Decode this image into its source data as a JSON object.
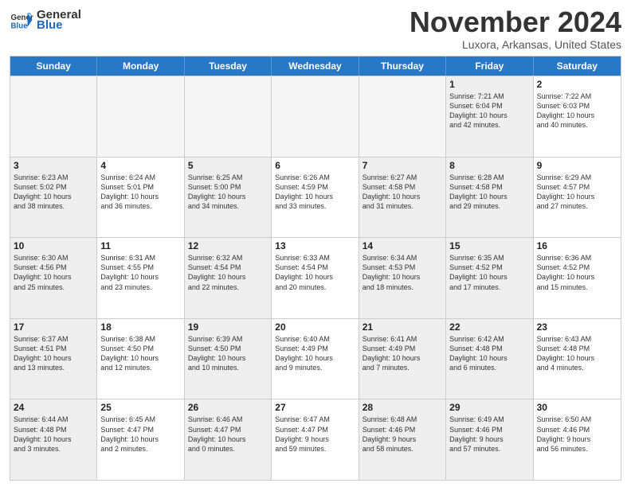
{
  "header": {
    "logo_general": "General",
    "logo_blue": "Blue",
    "month_title": "November 2024",
    "location": "Luxora, Arkansas, United States"
  },
  "weekdays": [
    "Sunday",
    "Monday",
    "Tuesday",
    "Wednesday",
    "Thursday",
    "Friday",
    "Saturday"
  ],
  "rows": [
    [
      {
        "day": "",
        "empty": true
      },
      {
        "day": "",
        "empty": true
      },
      {
        "day": "",
        "empty": true
      },
      {
        "day": "",
        "empty": true
      },
      {
        "day": "",
        "empty": true
      },
      {
        "day": "1",
        "info": "Sunrise: 7:21 AM\nSunset: 6:04 PM\nDaylight: 10 hours\nand 42 minutes.",
        "shaded": true
      },
      {
        "day": "2",
        "info": "Sunrise: 7:22 AM\nSunset: 6:03 PM\nDaylight: 10 hours\nand 40 minutes."
      }
    ],
    [
      {
        "day": "3",
        "info": "Sunrise: 6:23 AM\nSunset: 5:02 PM\nDaylight: 10 hours\nand 38 minutes.",
        "shaded": true
      },
      {
        "day": "4",
        "info": "Sunrise: 6:24 AM\nSunset: 5:01 PM\nDaylight: 10 hours\nand 36 minutes."
      },
      {
        "day": "5",
        "info": "Sunrise: 6:25 AM\nSunset: 5:00 PM\nDaylight: 10 hours\nand 34 minutes.",
        "shaded": true
      },
      {
        "day": "6",
        "info": "Sunrise: 6:26 AM\nSunset: 4:59 PM\nDaylight: 10 hours\nand 33 minutes."
      },
      {
        "day": "7",
        "info": "Sunrise: 6:27 AM\nSunset: 4:58 PM\nDaylight: 10 hours\nand 31 minutes.",
        "shaded": true
      },
      {
        "day": "8",
        "info": "Sunrise: 6:28 AM\nSunset: 4:58 PM\nDaylight: 10 hours\nand 29 minutes.",
        "shaded": true
      },
      {
        "day": "9",
        "info": "Sunrise: 6:29 AM\nSunset: 4:57 PM\nDaylight: 10 hours\nand 27 minutes."
      }
    ],
    [
      {
        "day": "10",
        "info": "Sunrise: 6:30 AM\nSunset: 4:56 PM\nDaylight: 10 hours\nand 25 minutes.",
        "shaded": true
      },
      {
        "day": "11",
        "info": "Sunrise: 6:31 AM\nSunset: 4:55 PM\nDaylight: 10 hours\nand 23 minutes."
      },
      {
        "day": "12",
        "info": "Sunrise: 6:32 AM\nSunset: 4:54 PM\nDaylight: 10 hours\nand 22 minutes.",
        "shaded": true
      },
      {
        "day": "13",
        "info": "Sunrise: 6:33 AM\nSunset: 4:54 PM\nDaylight: 10 hours\nand 20 minutes."
      },
      {
        "day": "14",
        "info": "Sunrise: 6:34 AM\nSunset: 4:53 PM\nDaylight: 10 hours\nand 18 minutes.",
        "shaded": true
      },
      {
        "day": "15",
        "info": "Sunrise: 6:35 AM\nSunset: 4:52 PM\nDaylight: 10 hours\nand 17 minutes.",
        "shaded": true
      },
      {
        "day": "16",
        "info": "Sunrise: 6:36 AM\nSunset: 4:52 PM\nDaylight: 10 hours\nand 15 minutes."
      }
    ],
    [
      {
        "day": "17",
        "info": "Sunrise: 6:37 AM\nSunset: 4:51 PM\nDaylight: 10 hours\nand 13 minutes.",
        "shaded": true
      },
      {
        "day": "18",
        "info": "Sunrise: 6:38 AM\nSunset: 4:50 PM\nDaylight: 10 hours\nand 12 minutes."
      },
      {
        "day": "19",
        "info": "Sunrise: 6:39 AM\nSunset: 4:50 PM\nDaylight: 10 hours\nand 10 minutes.",
        "shaded": true
      },
      {
        "day": "20",
        "info": "Sunrise: 6:40 AM\nSunset: 4:49 PM\nDaylight: 10 hours\nand 9 minutes."
      },
      {
        "day": "21",
        "info": "Sunrise: 6:41 AM\nSunset: 4:49 PM\nDaylight: 10 hours\nand 7 minutes.",
        "shaded": true
      },
      {
        "day": "22",
        "info": "Sunrise: 6:42 AM\nSunset: 4:48 PM\nDaylight: 10 hours\nand 6 minutes.",
        "shaded": true
      },
      {
        "day": "23",
        "info": "Sunrise: 6:43 AM\nSunset: 4:48 PM\nDaylight: 10 hours\nand 4 minutes."
      }
    ],
    [
      {
        "day": "24",
        "info": "Sunrise: 6:44 AM\nSunset: 4:48 PM\nDaylight: 10 hours\nand 3 minutes.",
        "shaded": true
      },
      {
        "day": "25",
        "info": "Sunrise: 6:45 AM\nSunset: 4:47 PM\nDaylight: 10 hours\nand 2 minutes."
      },
      {
        "day": "26",
        "info": "Sunrise: 6:46 AM\nSunset: 4:47 PM\nDaylight: 10 hours\nand 0 minutes.",
        "shaded": true
      },
      {
        "day": "27",
        "info": "Sunrise: 6:47 AM\nSunset: 4:47 PM\nDaylight: 9 hours\nand 59 minutes."
      },
      {
        "day": "28",
        "info": "Sunrise: 6:48 AM\nSunset: 4:46 PM\nDaylight: 9 hours\nand 58 minutes.",
        "shaded": true
      },
      {
        "day": "29",
        "info": "Sunrise: 6:49 AM\nSunset: 4:46 PM\nDaylight: 9 hours\nand 57 minutes.",
        "shaded": true
      },
      {
        "day": "30",
        "info": "Sunrise: 6:50 AM\nSunset: 4:46 PM\nDaylight: 9 hours\nand 56 minutes."
      }
    ]
  ]
}
